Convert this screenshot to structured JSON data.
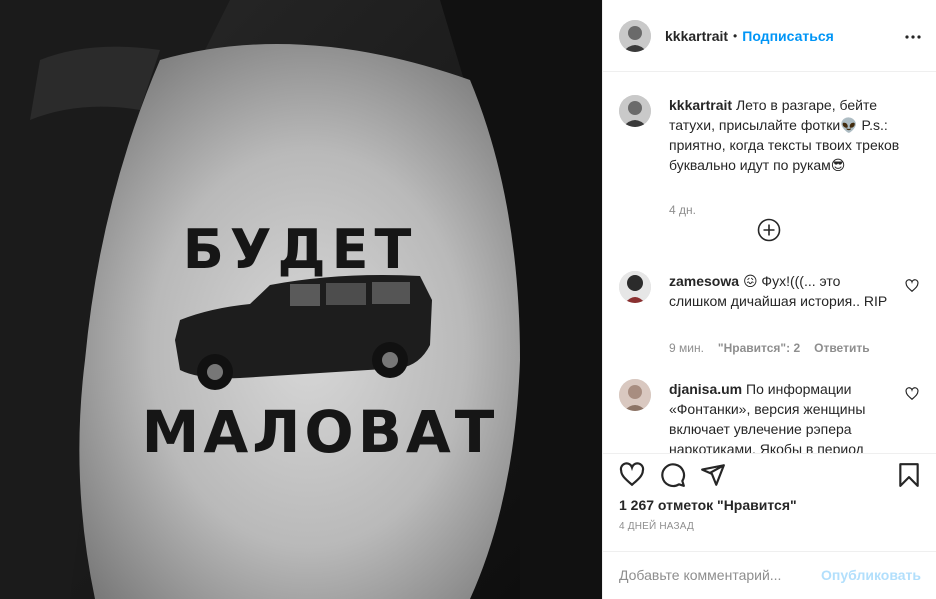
{
  "post": {
    "username": "kkkartrait",
    "separator": "•",
    "follow_label": "Подписаться",
    "more_label": "•••",
    "image_tattoo_text_top": "БУДЕТ",
    "image_tattoo_text_bottom": "МАЛОВАТ"
  },
  "caption": {
    "username": "kkkartrait",
    "text": "Лето в разгаре, бейте татухи, присылайте фотки👽 P.s.: приятно, когда тексты твоих треков буквально идут по рукам😎",
    "time": "4 дн."
  },
  "comments": [
    {
      "username": "zamesowa",
      "text": "😖 Фух!(((... это слишком дичайшая история.. RIP",
      "time": "9 мин.",
      "likes": "\"Нравится\": 2",
      "reply": "Ответить"
    },
    {
      "username": "djanisa.um",
      "text": "По информации «Фонтанки», версия женщины включает увлечение рэпера наркотиками. Якобы в период"
    }
  ],
  "actions": {
    "likes_text": "1 267 отметок \"Нравится\"",
    "date": "4 ДНЕЙ НАЗАД",
    "comment_placeholder": "Добавьте комментарий...",
    "post_label": "Опубликовать"
  },
  "icons": {
    "like": "heart-icon",
    "comment": "comment-icon",
    "share": "share-icon",
    "save": "bookmark-icon",
    "load_more": "plus-circle-icon"
  }
}
